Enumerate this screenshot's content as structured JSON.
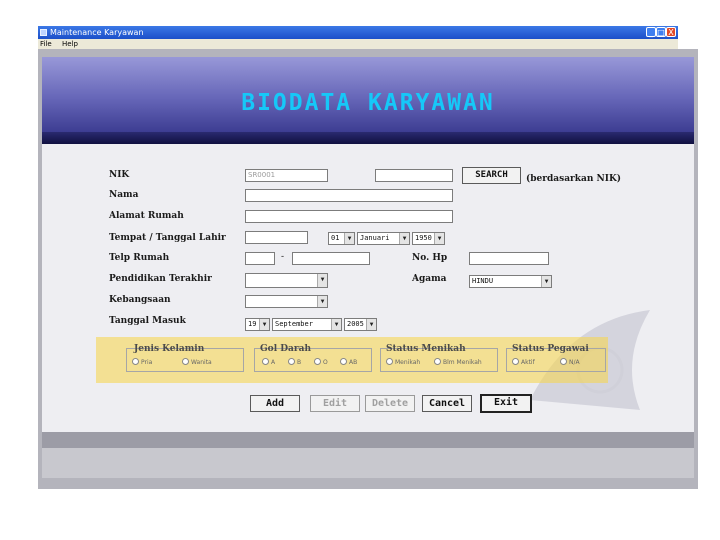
{
  "window": {
    "title": "Maintenance Karyawan",
    "menu": [
      "File",
      "Help"
    ],
    "controls": [
      "_",
      "□",
      "X"
    ]
  },
  "banner": {
    "title": "BIODATA KARYAWAN"
  },
  "form": {
    "nik": {
      "label": "NIK",
      "value": "SR0001",
      "search_value": ""
    },
    "search_button": "SEARCH",
    "search_note": "(berdasarkan NIK)",
    "nama": {
      "label": "Nama",
      "value": ""
    },
    "alamat": {
      "label": "Alamat Rumah",
      "value": ""
    },
    "ttl": {
      "label": "Tempat / Tanggal Lahir",
      "tempat": "",
      "day": "01",
      "month": "Januari",
      "year": "1950"
    },
    "telp": {
      "label": "Telp Rumah",
      "area": "",
      "dash": "-",
      "number": ""
    },
    "hp": {
      "label": "No. Hp",
      "value": ""
    },
    "pendidikan": {
      "label": "Pendidikan Terakhir",
      "value": ""
    },
    "agama": {
      "label": "Agama",
      "value": "HINDU"
    },
    "kebangsaan": {
      "label": "Kebangsaan",
      "value": ""
    },
    "tanggal_masuk": {
      "label": "Tanggal Masuk",
      "day": "19",
      "month": "September",
      "year": "2005"
    }
  },
  "groups": {
    "jenis_kelamin": {
      "title": "Jenis Kelamin",
      "options": [
        "Pria",
        "Wanita"
      ]
    },
    "gol_darah": {
      "title": "Gol Darah",
      "options": [
        "A",
        "B",
        "O",
        "AB"
      ]
    },
    "status_menikah": {
      "title": "Status Menikah",
      "options": [
        "Menikah",
        "Blm Menikah"
      ]
    },
    "status_pegawai": {
      "title": "Status Pegawai",
      "options": [
        "Aktif",
        "N/A"
      ]
    }
  },
  "buttons": {
    "add": "Add",
    "edit": "Edit",
    "delete": "Delete",
    "cancel": "Cancel",
    "exit": "Exit"
  },
  "colors": {
    "banner_title": "#16c8f8",
    "highlight": "#f8d646",
    "titlebar": "#1b4fc9"
  }
}
